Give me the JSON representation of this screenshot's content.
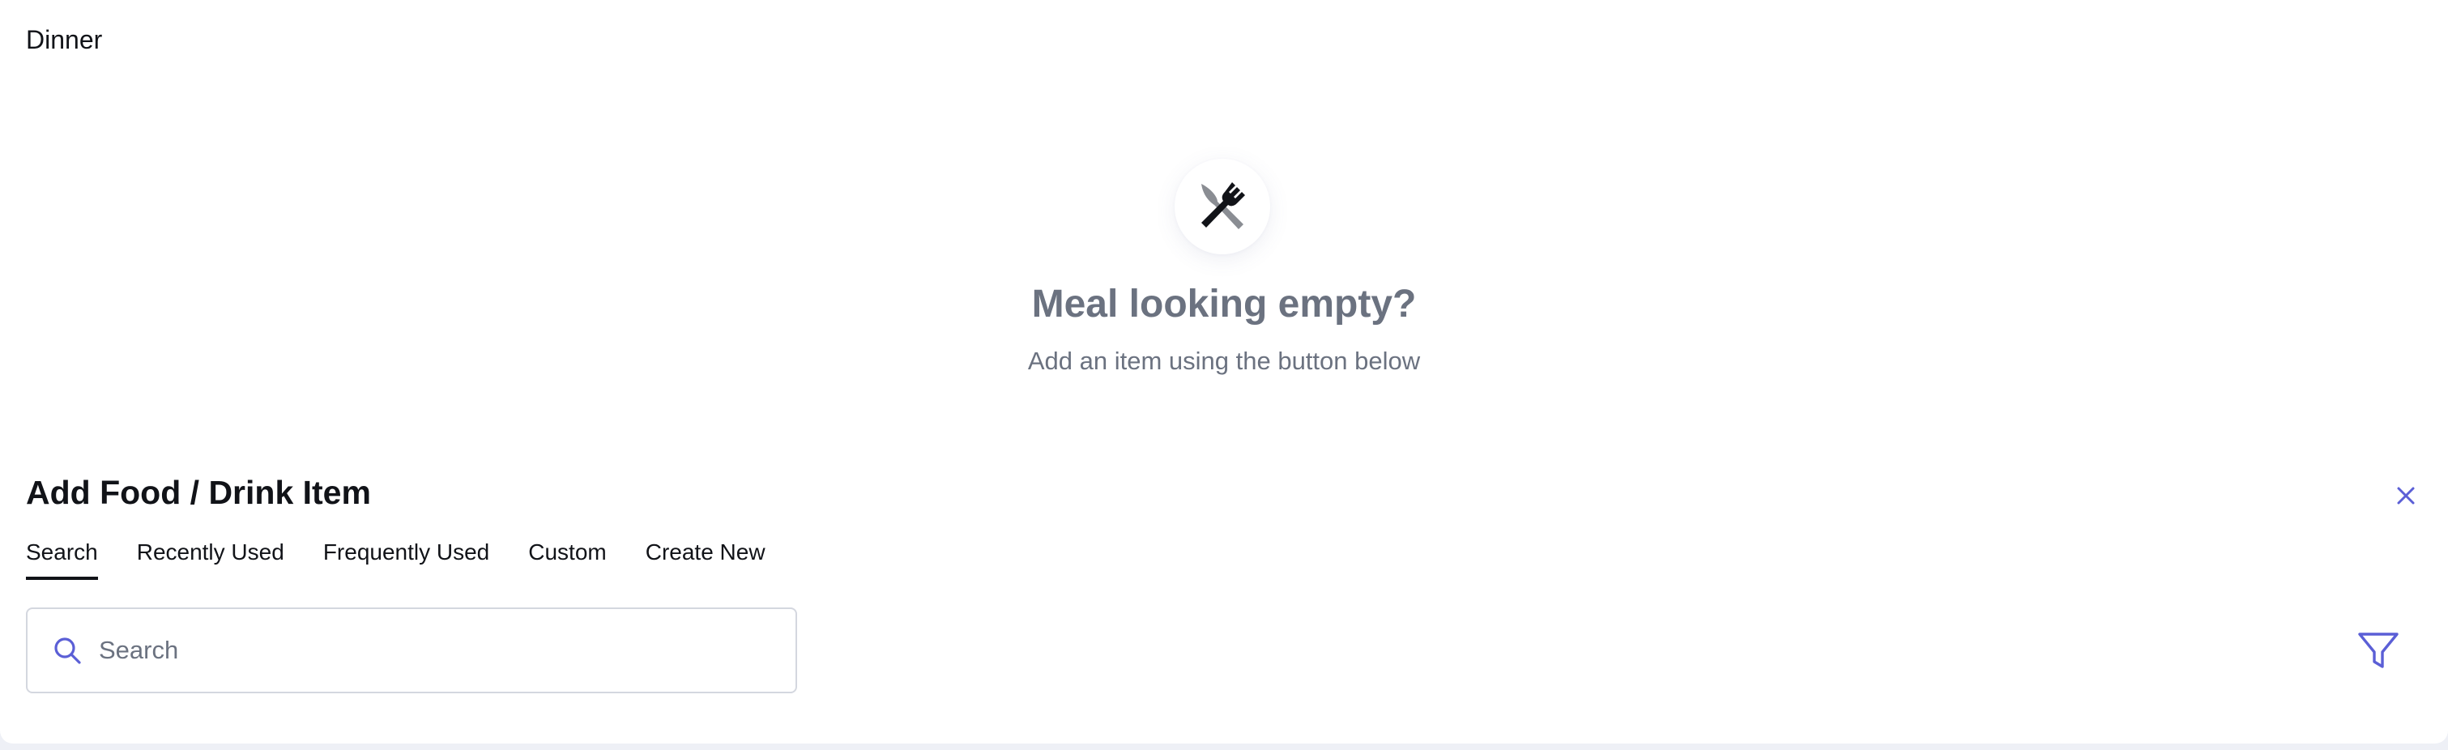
{
  "meal": {
    "title": "Dinner"
  },
  "empty_state": {
    "icon": "utensils-icon",
    "title": "Meal looking empty?",
    "subtitle": "Add an item using the button below"
  },
  "add_panel": {
    "title": "Add Food / Drink Item",
    "close_icon": "close-icon",
    "tabs": [
      {
        "label": "Search",
        "active": true
      },
      {
        "label": "Recently Used",
        "active": false
      },
      {
        "label": "Frequently Used",
        "active": false
      },
      {
        "label": "Custom",
        "active": false
      },
      {
        "label": "Create New",
        "active": false
      }
    ],
    "search": {
      "placeholder": "Search",
      "value": "",
      "icon": "search-icon"
    },
    "filter_icon": "filter-icon"
  },
  "colors": {
    "accent": "#5b5fd6",
    "muted_text": "#6b7280",
    "text": "#111318",
    "border": "#d4d7df"
  }
}
